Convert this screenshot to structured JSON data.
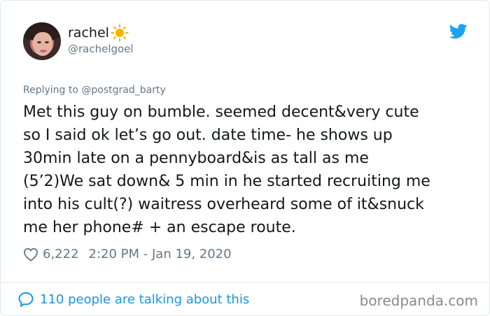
{
  "user": {
    "display_name": "rachel",
    "handle": "@rachelgoel",
    "name_emoji": "sun-icon"
  },
  "reply": {
    "prefix": "Replying to ",
    "mention": "@postgrad_barty"
  },
  "tweet": {
    "text": "Met this guy on bumble. seemed decent&very cute\nso I said ok let’s go out. date time- he shows up\n30min late on a pennyboard&is as tall as me\n(5’2)We sat down& 5 min in he started recruiting me\ninto his cult(?) waitress overheard some of it&snuck\nme her phone# + an escape route.",
    "likes": "6,222",
    "timestamp": "2:20 PM - Jan 19, 2020"
  },
  "footer": {
    "talking": "110 people are talking about this",
    "watermark": "boredpanda.com"
  },
  "colors": {
    "twitter_blue": "#1da1f2",
    "link_blue": "#1b95e0",
    "muted_gray": "#657786",
    "sun_yellow": "#f5b301"
  },
  "icons": [
    "twitter-bird-icon",
    "heart-icon",
    "comment-bubble-icon",
    "sun-icon"
  ]
}
